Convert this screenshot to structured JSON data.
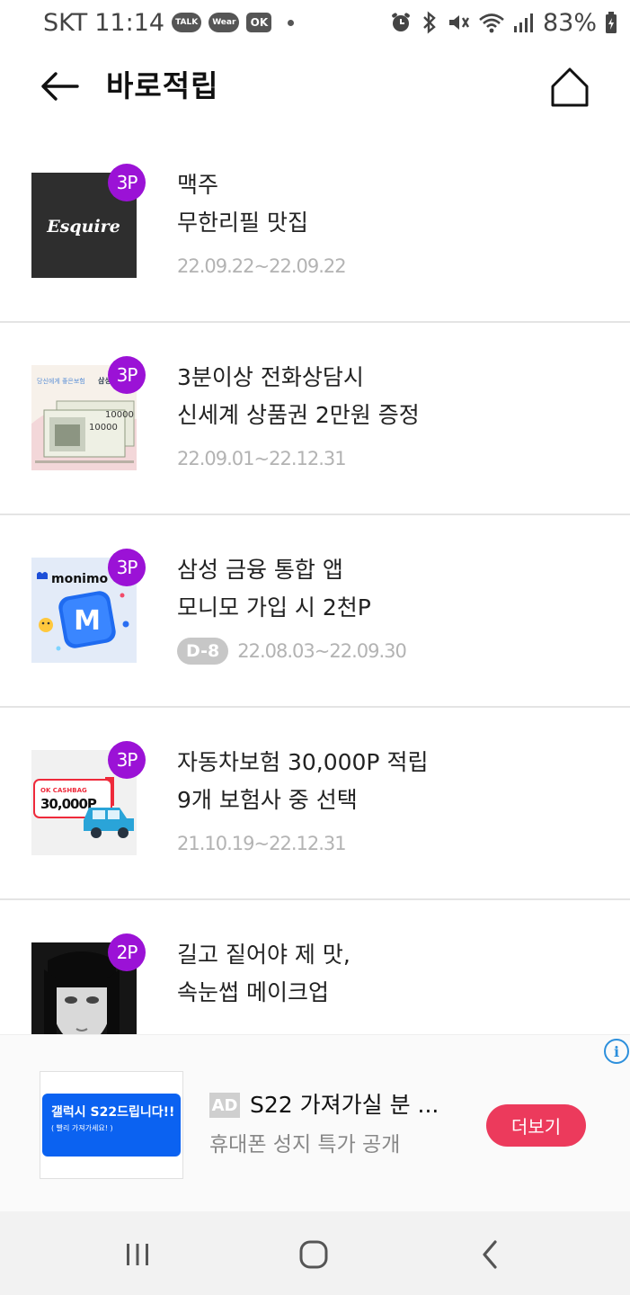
{
  "status_bar": {
    "carrier": "SKT",
    "time": "11:14",
    "notification_chips": [
      "TALK",
      "Wear",
      "OK"
    ],
    "battery": "83%"
  },
  "app_bar": {
    "title": "바로적립"
  },
  "list": [
    {
      "badge": "3P",
      "line1": "맥주",
      "line2": "무한리필 맛집",
      "period": "22.09.22~22.09.22",
      "dday": "",
      "thumb": {
        "brand_text": "Esquire"
      }
    },
    {
      "badge": "3P",
      "line1": "3분이상 전화상담시",
      "line2": "신세계 상품권 2만원 증정",
      "period": "22.09.01~22.12.31",
      "dday": "",
      "thumb": {
        "header_text": "당신에게 좋은보험",
        "header_brand": "삼성",
        "note1": "10000",
        "note2": "10000"
      }
    },
    {
      "badge": "3P",
      "line1": "삼성 금융 통합 앱",
      "line2": "모니모 가입 시 2천P",
      "period": "22.08.03~22.09.30",
      "dday": "D-8",
      "thumb": {
        "brand_text": "monimo",
        "tile_letter": "M"
      }
    },
    {
      "badge": "3P",
      "line1": "자동차보험 30,000P 적립",
      "line2": "9개 보험사 중 선택",
      "period": "21.10.19~22.12.31",
      "dday": "",
      "thumb": {
        "card_brand": "OK CASHBAG",
        "card_amount": "30,000P"
      }
    },
    {
      "badge": "2P",
      "line1": "길고 짙어야 제 맛,",
      "line2": "속눈썹 메이크업",
      "period": "",
      "dday": "",
      "thumb": {}
    }
  ],
  "ad": {
    "tag": "AD",
    "title": "S22 가져가실 분 ...",
    "subtitle": "휴대폰 성지 특가 공개",
    "image_title": "갤럭시 S22드립니다!!",
    "image_subtitle": "( 빨리 가져가세요! )",
    "button": "더보기",
    "info": "i"
  },
  "colors": {
    "badge_purple": "#9b12d6",
    "ad_button": "#ec3a5c",
    "period_gray": "#b3b3b3",
    "divider": "#e4e4e4"
  },
  "icons": [
    "back-arrow-icon",
    "home-icon",
    "recent-apps-icon",
    "nav-home-icon",
    "nav-back-icon",
    "info-icon"
  ]
}
